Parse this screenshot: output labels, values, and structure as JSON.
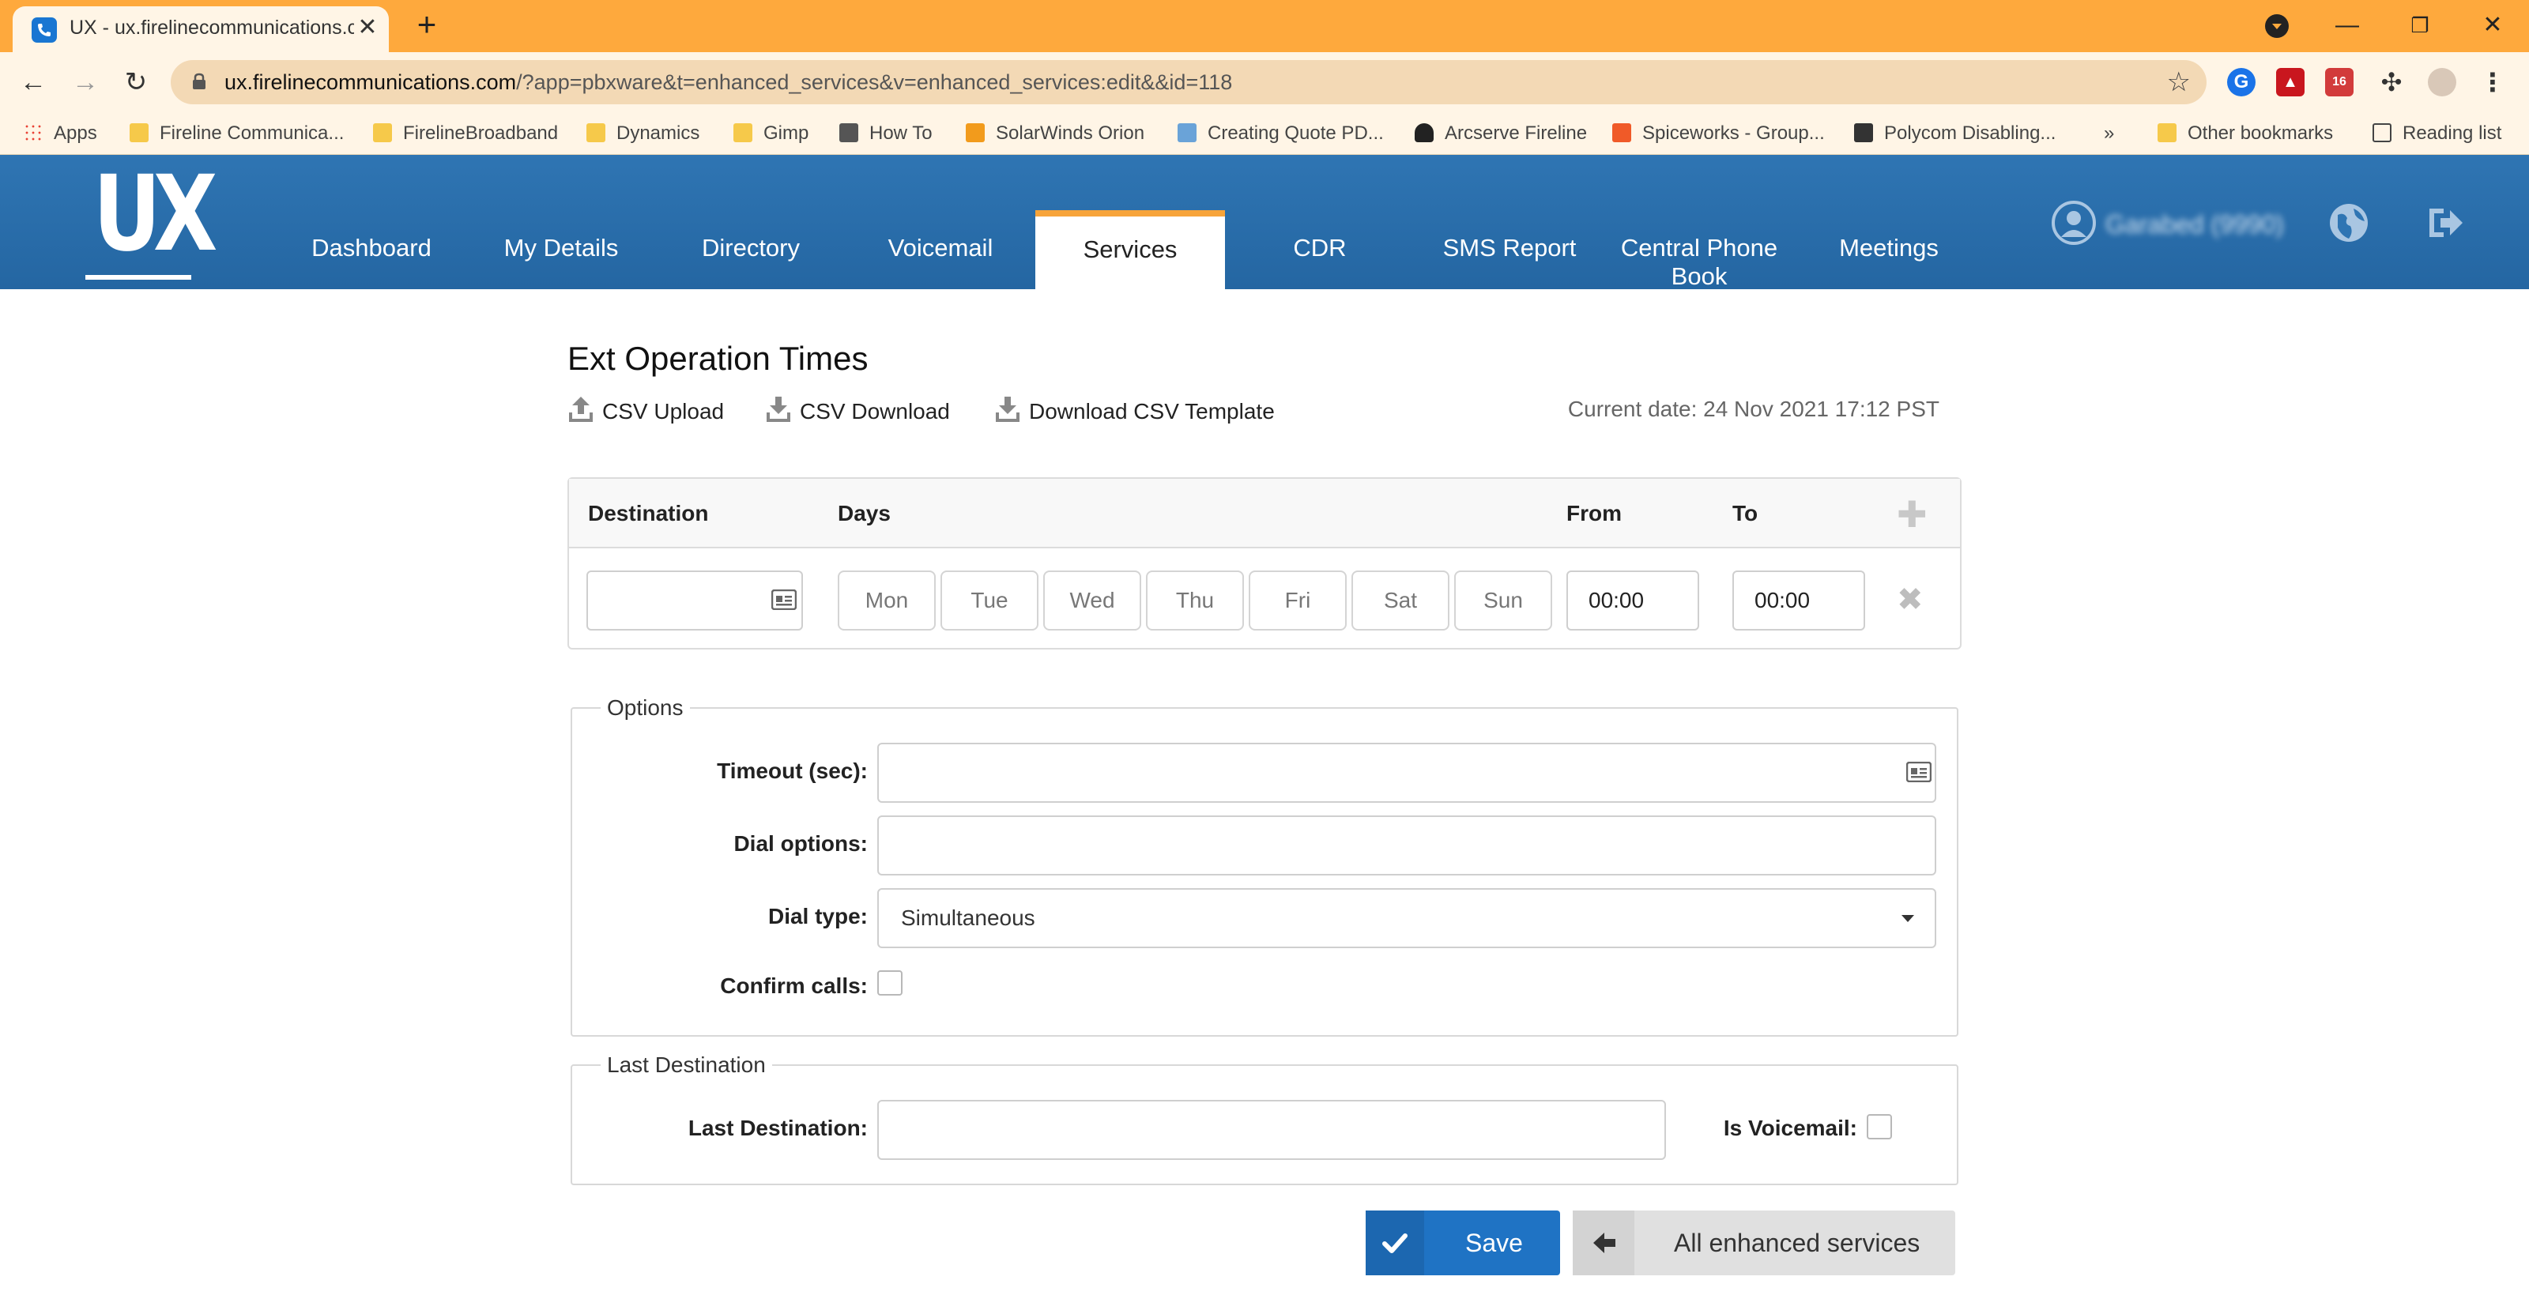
{
  "browser": {
    "tab_title": "UX - ux.firelinecommunications.c",
    "url_host": "ux.firelinecommunications.com",
    "url_path": "/?app=pbxware&t=enhanced_services&v=enhanced_services:edit&&id=118",
    "extension_badge": "16",
    "bookmarks": [
      "Apps",
      "Fireline Communica...",
      "FirelineBroadband",
      "Dynamics",
      "Gimp",
      "How To",
      "SolarWinds Orion",
      "Creating Quote PD...",
      "Arcserve Fireline",
      "Spiceworks - Group...",
      "Polycom Disabling..."
    ],
    "bookmarks_overflow": "»",
    "other_bookmarks": "Other bookmarks",
    "reading_list": "Reading list"
  },
  "header": {
    "logo": "UX",
    "nav": [
      "Dashboard",
      "My Details",
      "Directory",
      "Voicemail",
      "Services",
      "CDR",
      "SMS Report",
      "Central Phone Book",
      "Meetings"
    ],
    "nav_central_1": "Central Phone",
    "nav_central_2": "Book",
    "active": "Services",
    "user": "Garabed (9990)"
  },
  "page": {
    "title": "Ext Operation Times",
    "csv_upload": "CSV Upload",
    "csv_download": "CSV Download",
    "download_template": "Download CSV Template",
    "current_date": "Current date: 24 Nov 2021 17:12 PST"
  },
  "table": {
    "headers": {
      "destination": "Destination",
      "days": "Days",
      "from": "From",
      "to": "To"
    },
    "days": [
      "Mon",
      "Tue",
      "Wed",
      "Thu",
      "Fri",
      "Sat",
      "Sun"
    ],
    "from": "00:00",
    "to": "00:00",
    "destination": ""
  },
  "options": {
    "legend": "Options",
    "timeout_label": "Timeout (sec):",
    "dial_options_label": "Dial options:",
    "dial_type_label": "Dial type:",
    "dial_type_value": "Simultaneous",
    "confirm_calls_label": "Confirm calls:"
  },
  "last_destination": {
    "legend": "Last Destination",
    "label": "Last Destination:",
    "is_voicemail_label": "Is Voicemail:"
  },
  "buttons": {
    "save": "Save",
    "all_services": "All enhanced services"
  },
  "colors": {
    "chrome_orange": "#fea93d",
    "header_blue": "#2f75b3",
    "accent_orange": "#f7a43a",
    "save_blue": "#1f73c4"
  }
}
